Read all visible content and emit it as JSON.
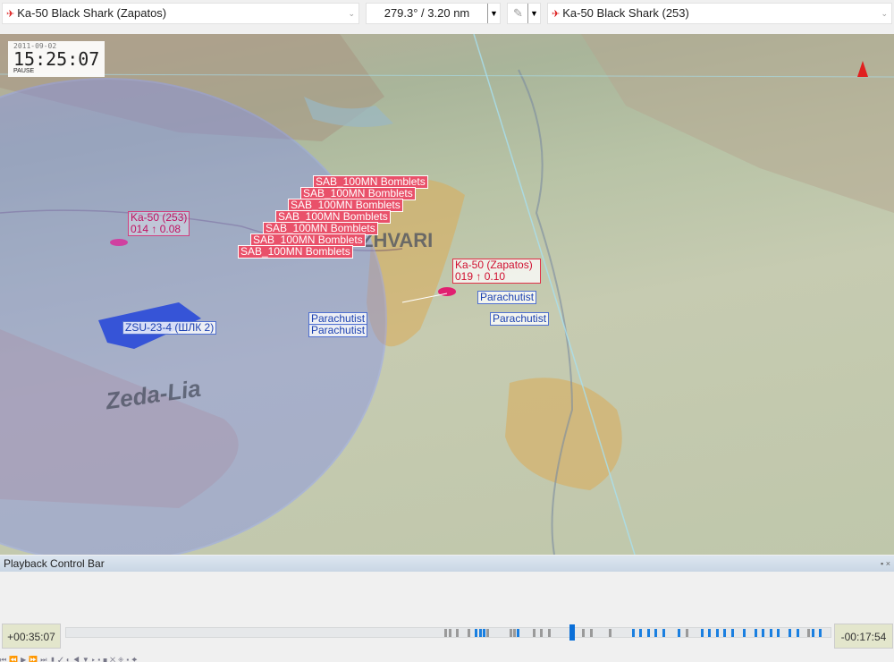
{
  "topbar": {
    "left_unit": "Ka-50 Black Shark (Zapatos)",
    "bearing": "279.3° / 3.20 nm",
    "right_unit": "Ka-50 Black Shark (253)",
    "mode_icon": "✎"
  },
  "clock": {
    "date": "2011-09-02",
    "time": "15:25:07",
    "state": "PAUSE"
  },
  "map": {
    "towns": [
      "ZHVARI",
      "Zeda-Lia"
    ],
    "bomblets": [
      "SAB_100MN Bomblets",
      "SAB_100MN Bomblets",
      "SAB_100MN Bomblets",
      "SAB_100MN Bomblets",
      "SAB_100MN Bomblets",
      "SAB_100MN Bomblets",
      "SAB_100MN Bomblets"
    ],
    "ka50_253": {
      "name": "Ka-50 (253)",
      "info": "014 ↑ 0.08"
    },
    "ka50_zapatos": {
      "name": "Ka-50 (Zapatos)",
      "info": "019 ↑ 0.10"
    },
    "parachutists": [
      "Parachutist",
      "Parachutist",
      "Parachutist",
      "Parachutist"
    ],
    "sam": "ZSU-23-4 (ШЛК 2)"
  },
  "playback": {
    "title": "Playback Control Bar",
    "elapsed": "+00:35:07",
    "remaining": "-00:17:54",
    "progress": 0.662,
    "events": [
      [
        0.495,
        "g"
      ],
      [
        0.5,
        "g"
      ],
      [
        0.51,
        "g"
      ],
      [
        0.525,
        "g"
      ],
      [
        0.535,
        "b"
      ],
      [
        0.54,
        "b"
      ],
      [
        0.545,
        "b"
      ],
      [
        0.55,
        "g"
      ],
      [
        0.58,
        "g"
      ],
      [
        0.585,
        "g"
      ],
      [
        0.59,
        "b"
      ],
      [
        0.61,
        "g"
      ],
      [
        0.62,
        "g"
      ],
      [
        0.63,
        "g"
      ],
      [
        0.675,
        "g"
      ],
      [
        0.685,
        "g"
      ],
      [
        0.71,
        "g"
      ],
      [
        0.74,
        "b"
      ],
      [
        0.75,
        "b"
      ],
      [
        0.76,
        "b"
      ],
      [
        0.77,
        "b"
      ],
      [
        0.78,
        "b"
      ],
      [
        0.8,
        "b"
      ],
      [
        0.81,
        "g"
      ],
      [
        0.83,
        "b"
      ],
      [
        0.84,
        "b"
      ],
      [
        0.85,
        "b"
      ],
      [
        0.86,
        "b"
      ],
      [
        0.87,
        "b"
      ],
      [
        0.885,
        "b"
      ],
      [
        0.9,
        "b"
      ],
      [
        0.91,
        "b"
      ],
      [
        0.92,
        "b"
      ],
      [
        0.93,
        "b"
      ],
      [
        0.945,
        "b"
      ],
      [
        0.955,
        "b"
      ],
      [
        0.97,
        "g"
      ],
      [
        0.975,
        "b"
      ],
      [
        0.985,
        "b"
      ]
    ]
  }
}
